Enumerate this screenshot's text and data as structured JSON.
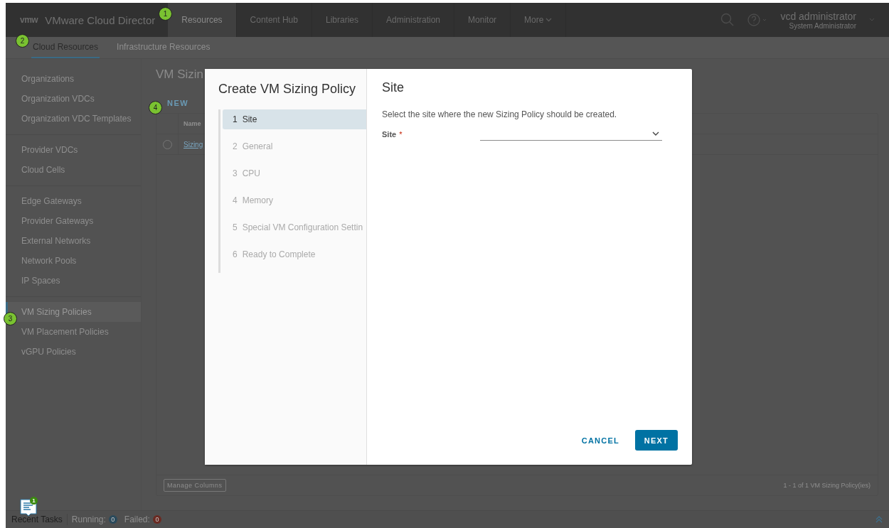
{
  "header": {
    "logo": "vmw",
    "title": "VMware Cloud Director",
    "nav": [
      {
        "label": "Resources",
        "selected": true
      },
      {
        "label": "Content Hub",
        "selected": false
      },
      {
        "label": "Libraries",
        "selected": false
      },
      {
        "label": "Administration",
        "selected": false
      },
      {
        "label": "Monitor",
        "selected": false
      },
      {
        "label": "More",
        "selected": false
      }
    ],
    "user": {
      "name": "vcd administrator",
      "role": "System Administrator"
    }
  },
  "subnav": [
    {
      "label": "Cloud Resources",
      "selected": true
    },
    {
      "label": "Infrastructure Resources",
      "selected": false
    }
  ],
  "sidebar": {
    "groups": [
      {
        "items": [
          {
            "label": "Organizations",
            "selected": false
          },
          {
            "label": "Organization VDCs",
            "selected": false
          },
          {
            "label": "Organization VDC Templates",
            "selected": false
          }
        ]
      },
      {
        "items": [
          {
            "label": "Provider VDCs",
            "selected": false
          },
          {
            "label": "Cloud Cells",
            "selected": false
          }
        ]
      },
      {
        "items": [
          {
            "label": "Edge Gateways",
            "selected": false
          },
          {
            "label": "Provider Gateways",
            "selected": false
          },
          {
            "label": "External Networks",
            "selected": false
          },
          {
            "label": "Network Pools",
            "selected": false
          },
          {
            "label": "IP Spaces",
            "selected": false
          }
        ]
      },
      {
        "items": [
          {
            "label": "VM Sizing Policies",
            "selected": true
          },
          {
            "label": "VM Placement Policies",
            "selected": false
          },
          {
            "label": "vGPU Policies",
            "selected": false
          }
        ]
      }
    ]
  },
  "page": {
    "title": "VM Sizin",
    "new_button": "NEW",
    "table": {
      "columns": [
        "Name"
      ],
      "rows": [
        {
          "selected": false,
          "name": "Sizing"
        }
      ]
    },
    "manage_columns": "Manage Columns",
    "footer": "1 - 1 of 1 VM Sizing Policy(ies)"
  },
  "modal": {
    "title": "Create VM Sizing Policy",
    "steps": [
      {
        "number": "1",
        "label": "Site",
        "selected": true
      },
      {
        "number": "2",
        "label": "General",
        "selected": false
      },
      {
        "number": "3",
        "label": "CPU",
        "selected": false
      },
      {
        "number": "4",
        "label": "Memory",
        "selected": false
      },
      {
        "number": "5",
        "label": "Special VM Configuration Settin",
        "selected": false
      },
      {
        "number": "6",
        "label": "Ready to Complete",
        "selected": false
      }
    ],
    "heading": "Site",
    "description": "Select the site where the new Sizing Policy should be created.",
    "fields": [
      {
        "label": "Site",
        "required_mark": "*"
      }
    ],
    "cancel": "CANCEL",
    "next": "NEXT"
  },
  "task_bar": {
    "notification_count": "1",
    "label": "Recent Tasks",
    "running": {
      "label": "Running:",
      "count": "0"
    },
    "failed": {
      "label": "Failed:",
      "count": "0"
    }
  },
  "callouts": [
    "1",
    "2",
    "3",
    "4"
  ]
}
